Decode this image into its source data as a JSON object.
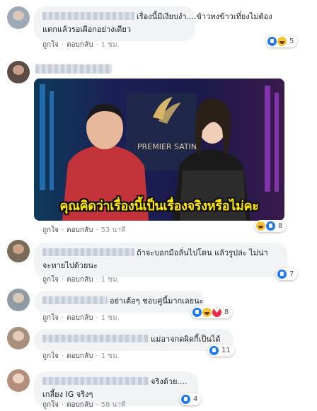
{
  "action_labels": {
    "like": "ถูกใจ",
    "reply": "ตอบกลับ",
    "dot": "·"
  },
  "comments": [
    {
      "lines": [
        "เรื่องนี้มีเงียบงำ....ข้าวทงข้าวเที่ยงไม่ต้อง",
        "แดกแล้วรอเผือกอย่างเดียว"
      ],
      "time": "1 ชม.",
      "reactions": [
        "like",
        "haha"
      ],
      "reaction_count": "5"
    },
    {
      "image_caption": "คุณคิดว่าเรื่องนี้เป็นเรื่องจริงหรือไม่คะ",
      "image_brand": "PREMIER SATIN",
      "time": "53 นาที",
      "reactions": [
        "haha",
        "like"
      ],
      "reaction_count": "8"
    },
    {
      "lines": [
        "ถ้าจะบอกมือลั่นไปโดน แล้วรูปล่ะ ไม่น่า",
        "จะหายไปด้วยนะ"
      ],
      "time": "1 ชม.",
      "reactions": [
        "like"
      ],
      "reaction_count": "7"
    },
    {
      "lines": [
        "อย่าเต้อๆ ชอบคู่นี้มากเลยนะ"
      ],
      "time": "1 ชม.",
      "reactions": [
        "like",
        "haha",
        "love"
      ],
      "reaction_count": "8"
    },
    {
      "lines": [
        "แม่อาจกดผิดกี้เป็นได้"
      ],
      "time": "1 ชม.",
      "reactions": [
        "like"
      ],
      "reaction_count": "11"
    },
    {
      "lines": [
        "จริงด้วย....",
        "เกลี้ยง IG จริงๆ"
      ],
      "time": "58 นาที",
      "reactions": [
        "like"
      ],
      "reaction_count": "4"
    }
  ],
  "colors": {
    "link": "#4b4f56",
    "muted": "#90949c",
    "bubble": "#f2f3f5",
    "like": "#2078f4",
    "haha": "#f7c52f",
    "love": "#f0284a",
    "caption_yellow": "#ffe600"
  },
  "icons": [
    "like-reaction-icon",
    "haha-reaction-icon",
    "love-reaction-icon"
  ]
}
